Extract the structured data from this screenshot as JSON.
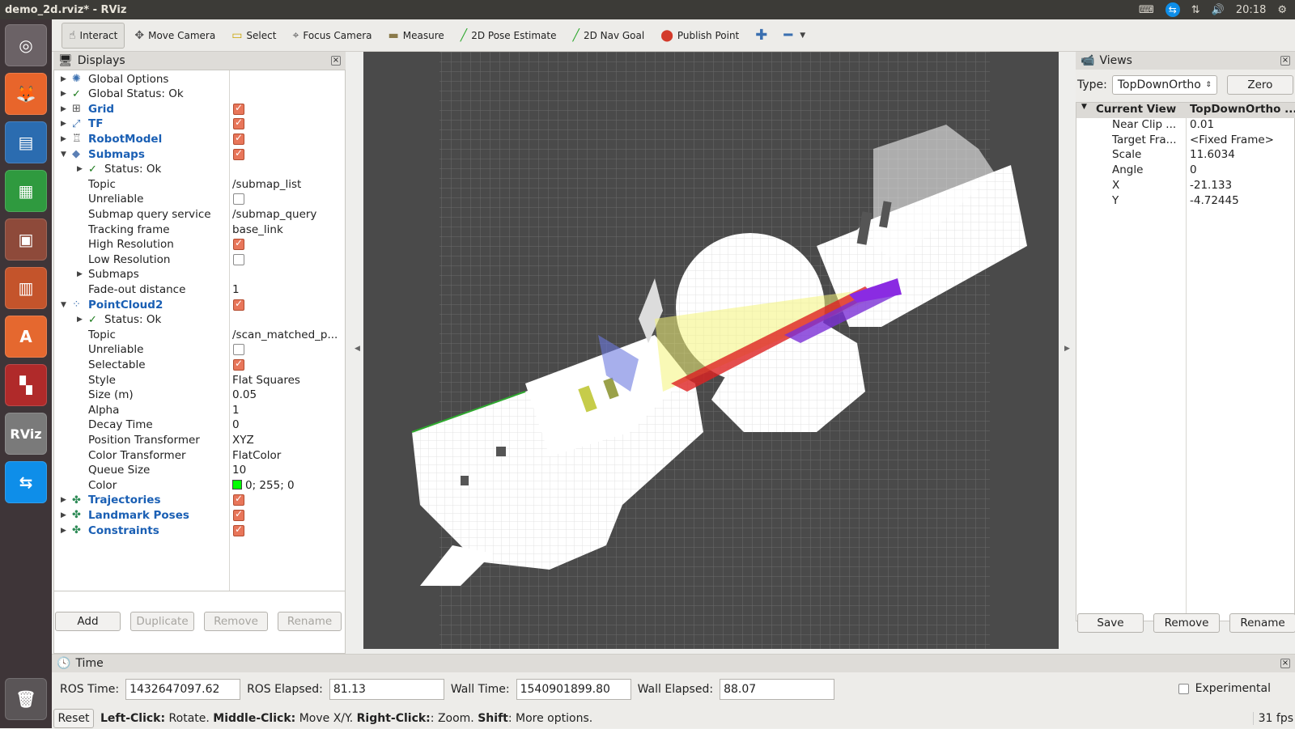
{
  "window": {
    "title": "demo_2d.rviz* - RViz",
    "clock": "20:18"
  },
  "toolbar": {
    "tools": [
      {
        "label": "Interact",
        "icon": "hand-icon",
        "glyph": "☝",
        "color": "#555555"
      },
      {
        "label": "Move Camera",
        "icon": "move-camera-icon",
        "glyph": "✥",
        "color": "#555555"
      },
      {
        "label": "Select",
        "icon": "select-icon",
        "glyph": "▭",
        "color": "#c9a300"
      },
      {
        "label": "Focus Camera",
        "icon": "focus-camera-icon",
        "glyph": "⌖",
        "color": "#555555"
      },
      {
        "label": "Measure",
        "icon": "ruler-icon",
        "glyph": "▬",
        "color": "#8a7a4a"
      },
      {
        "label": "2D Pose Estimate",
        "icon": "pose-arrow-icon",
        "glyph": "╱",
        "color": "#2fa82f"
      },
      {
        "label": "2D Nav Goal",
        "icon": "nav-goal-arrow-icon",
        "glyph": "╱",
        "color": "#2fa82f"
      },
      {
        "label": "Publish Point",
        "icon": "map-pin-icon",
        "glyph": "⬤",
        "color": "#d33a2a"
      }
    ]
  },
  "displays": {
    "title": "Displays",
    "rows": [
      {
        "label": "Global Options",
        "indent": 0,
        "arrow": "▶",
        "icon": "globe-icon",
        "glyph": "✺",
        "iconColor": "#3a6fb0",
        "blue": false
      },
      {
        "label": "Global Status: Ok",
        "indent": 0,
        "arrow": "▶",
        "icon": "check-icon",
        "glyph": "✓",
        "iconColor": "#1b7a1b",
        "blue": false
      },
      {
        "label": "Grid",
        "indent": 0,
        "arrow": "▶",
        "icon": "grid-icon",
        "glyph": "⊞",
        "iconColor": "#555",
        "blue": true,
        "check": true
      },
      {
        "label": "TF",
        "indent": 0,
        "arrow": "▶",
        "icon": "axes-icon",
        "glyph": "⤢",
        "iconColor": "#3a6fb0",
        "blue": true,
        "check": true
      },
      {
        "label": "RobotModel",
        "indent": 0,
        "arrow": "▶",
        "icon": "robot-icon",
        "glyph": "♖",
        "iconColor": "#555",
        "blue": true,
        "check": true
      },
      {
        "label": "Submaps",
        "indent": 0,
        "arrow": "▼",
        "icon": "submaps-icon",
        "glyph": "◆",
        "iconColor": "#5b7fb5",
        "blue": true,
        "check": true
      },
      {
        "label": "Status: Ok",
        "indent": 1,
        "arrow": "▶",
        "icon": "check-icon",
        "glyph": "✓",
        "iconColor": "#1b7a1b",
        "blue": false
      },
      {
        "label": "Topic",
        "indent": 2,
        "value": "/submap_list"
      },
      {
        "label": "Unreliable",
        "indent": 2,
        "check": false
      },
      {
        "label": "Submap query service",
        "indent": 2,
        "value": "/submap_query"
      },
      {
        "label": "Tracking frame",
        "indent": 2,
        "value": "base_link"
      },
      {
        "label": "High Resolution",
        "indent": 2,
        "check": true
      },
      {
        "label": "Low Resolution",
        "indent": 2,
        "check": false
      },
      {
        "label": "Submaps",
        "indent": 2,
        "arrow": "▶"
      },
      {
        "label": "Fade-out distance",
        "indent": 2,
        "value": "1"
      },
      {
        "label": "PointCloud2",
        "indent": 0,
        "arrow": "▼",
        "icon": "pointcloud-icon",
        "glyph": "⁘",
        "iconColor": "#3a6fb0",
        "blue": true,
        "check": true
      },
      {
        "label": "Status: Ok",
        "indent": 1,
        "arrow": "▶",
        "icon": "check-icon",
        "glyph": "✓",
        "iconColor": "#1b7a1b",
        "blue": false
      },
      {
        "label": "Topic",
        "indent": 2,
        "value": "/scan_matched_p..."
      },
      {
        "label": "Unreliable",
        "indent": 2,
        "check": false
      },
      {
        "label": "Selectable",
        "indent": 2,
        "check": true
      },
      {
        "label": "Style",
        "indent": 2,
        "value": "Flat Squares"
      },
      {
        "label": "Size (m)",
        "indent": 2,
        "value": "0.05"
      },
      {
        "label": "Alpha",
        "indent": 2,
        "value": "1"
      },
      {
        "label": "Decay Time",
        "indent": 2,
        "value": "0"
      },
      {
        "label": "Position Transformer",
        "indent": 2,
        "value": "XYZ"
      },
      {
        "label": "Color Transformer",
        "indent": 2,
        "value": "FlatColor"
      },
      {
        "label": "Queue Size",
        "indent": 2,
        "value": "10"
      },
      {
        "label": "Color",
        "indent": 2,
        "value": "0; 255; 0",
        "swatch": "#00ff00"
      },
      {
        "label": "Trajectories",
        "indent": 0,
        "arrow": "▶",
        "icon": "markers-icon",
        "glyph": "✤",
        "iconColor": "#2e8b57",
        "blue": true,
        "check": true
      },
      {
        "label": "Landmark Poses",
        "indent": 0,
        "arrow": "▶",
        "icon": "markers-icon",
        "glyph": "✤",
        "iconColor": "#2e8b57",
        "blue": true,
        "check": true
      },
      {
        "label": "Constraints",
        "indent": 0,
        "arrow": "▶",
        "icon": "markers-icon",
        "glyph": "✤",
        "iconColor": "#2e8b57",
        "blue": true,
        "check": true
      }
    ],
    "buttons": [
      "Add",
      "Duplicate",
      "Remove",
      "Rename"
    ]
  },
  "views": {
    "title": "Views",
    "type_label": "Type:",
    "type_value": "TopDownOrtho",
    "zero_label": "Zero",
    "current_view": {
      "key": "Current View",
      "value": "TopDownOrtho ..."
    },
    "props": [
      {
        "key": "Near Clip ...",
        "value": "0.01"
      },
      {
        "key": "Target Fra...",
        "value": "<Fixed Frame>"
      },
      {
        "key": "Scale",
        "value": "11.6034"
      },
      {
        "key": "Angle",
        "value": "0"
      },
      {
        "key": "X",
        "value": "-21.133"
      },
      {
        "key": "Y",
        "value": "-4.72445"
      }
    ],
    "buttons": [
      "Save",
      "Remove",
      "Rename"
    ]
  },
  "time": {
    "title": "Time",
    "ros_time_label": "ROS Time:",
    "ros_time": "1432647097.62",
    "ros_elapsed_label": "ROS Elapsed:",
    "ros_elapsed": "81.13",
    "wall_time_label": "Wall Time:",
    "wall_time": "1540901899.80",
    "wall_elapsed_label": "Wall Elapsed:",
    "wall_elapsed": "88.07",
    "experimental_label": "Experimental"
  },
  "status": {
    "reset_label": "Reset",
    "hint_parts": [
      {
        "text": "Left-Click:",
        "bold": true
      },
      {
        "text": " Rotate. ",
        "bold": false
      },
      {
        "text": "Middle-Click:",
        "bold": true
      },
      {
        "text": " Move X/Y. ",
        "bold": false
      },
      {
        "text": "Right-Click:",
        "bold": true
      },
      {
        "text": ": Zoom. ",
        "bold": false
      },
      {
        "text": "Shift",
        "bold": true
      },
      {
        "text": ": More options.",
        "bold": false
      }
    ],
    "fps": "31 fps"
  },
  "launcher": [
    {
      "name": "ubuntu-dash-icon",
      "glyph": "◎",
      "bg": "#6b6266"
    },
    {
      "name": "firefox-icon",
      "glyph": "🦊",
      "bg": "#e8652b"
    },
    {
      "name": "writer-icon",
      "glyph": "▤",
      "bg": "#2b6cb0"
    },
    {
      "name": "calc-icon",
      "glyph": "▦",
      "bg": "#2f9a3f"
    },
    {
      "name": "files-icon",
      "glyph": "▣",
      "bg": "#8e4a3a"
    },
    {
      "name": "impress-icon",
      "glyph": "▥",
      "bg": "#c4542b"
    },
    {
      "name": "software-center-icon",
      "glyph": "A",
      "bg": "#e5682f"
    },
    {
      "name": "terminal-app-icon",
      "glyph": "▚",
      "bg": "#b02a2a"
    },
    {
      "name": "rviz-icon",
      "glyph": "RViz",
      "bg": "#7a7a7a"
    },
    {
      "name": "teamviewer-icon",
      "glyph": "⇆",
      "bg": "#0e8ee9"
    }
  ]
}
